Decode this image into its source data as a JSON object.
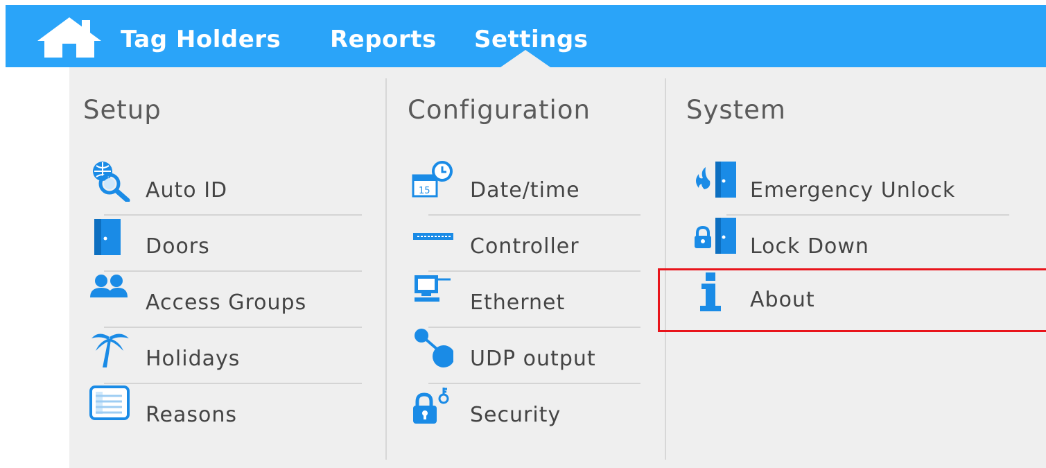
{
  "navbar": {
    "home_icon": "home-icon",
    "items": [
      {
        "label": "Tag Holders"
      },
      {
        "label": "Reports"
      },
      {
        "label": "Settings"
      }
    ]
  },
  "columns": [
    {
      "title": "Setup",
      "items": [
        {
          "label": "Auto ID",
          "icon": "auto-id-icon"
        },
        {
          "label": "Doors",
          "icon": "door-icon"
        },
        {
          "label": "Access Groups",
          "icon": "access-groups-icon"
        },
        {
          "label": "Holidays",
          "icon": "palm-tree-icon"
        },
        {
          "label": "Reasons",
          "icon": "reasons-list-icon"
        }
      ]
    },
    {
      "title": "Configuration",
      "items": [
        {
          "label": "Date/time",
          "icon": "calendar-clock-icon"
        },
        {
          "label": "Controller",
          "icon": "controller-icon"
        },
        {
          "label": "Ethernet",
          "icon": "ethernet-icon"
        },
        {
          "label": "UDP output",
          "icon": "udp-output-icon"
        },
        {
          "label": "Security",
          "icon": "lock-key-icon"
        }
      ]
    },
    {
      "title": "System",
      "items": [
        {
          "label": "Emergency Unlock",
          "icon": "emergency-unlock-icon"
        },
        {
          "label": "Lock Down",
          "icon": "lock-down-icon"
        },
        {
          "label": "About",
          "icon": "info-icon"
        }
      ]
    }
  ],
  "colors": {
    "navbar": "#2aa4f9",
    "panel": "#efefef",
    "icon_blue": "#1a8be6",
    "highlight": "#e8141b"
  }
}
